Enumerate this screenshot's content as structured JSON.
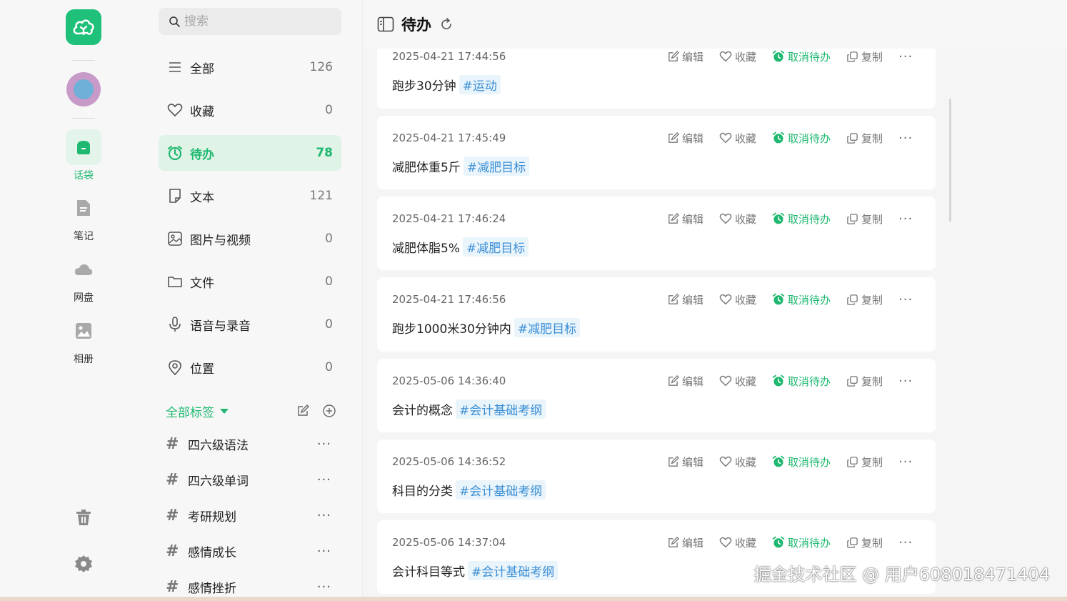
{
  "rail": {
    "nav": [
      {
        "label": "话袋",
        "icon": "bag-icon",
        "active": true
      },
      {
        "label": "笔记",
        "icon": "note-icon",
        "active": false
      },
      {
        "label": "网盘",
        "icon": "cloud-icon",
        "active": false
      },
      {
        "label": "相册",
        "icon": "photo-icon",
        "active": false
      }
    ],
    "bottom_icons": [
      "trash-icon",
      "gear-icon"
    ]
  },
  "search": {
    "placeholder": "搜索"
  },
  "categories": [
    {
      "label": "全部",
      "count": "126",
      "icon": "list-icon"
    },
    {
      "label": "收藏",
      "count": "0",
      "icon": "heart-icon"
    },
    {
      "label": "待办",
      "count": "78",
      "icon": "alarm-icon",
      "active": true
    },
    {
      "label": "文本",
      "count": "121",
      "icon": "doc-icon"
    },
    {
      "label": "图片与视频",
      "count": "0",
      "icon": "image-icon"
    },
    {
      "label": "文件",
      "count": "0",
      "icon": "folder-icon"
    },
    {
      "label": "语音与录音",
      "count": "0",
      "icon": "mic-icon"
    },
    {
      "label": "位置",
      "count": "0",
      "icon": "location-icon"
    }
  ],
  "tags": {
    "header": "全部标签",
    "items": [
      {
        "label": "四六级语法",
        "more": "···"
      },
      {
        "label": "四六级单词",
        "more": "···"
      },
      {
        "label": "考研规划",
        "more": "···"
      },
      {
        "label": "感情成长",
        "more": "···"
      },
      {
        "label": "感情挫折",
        "more": "···"
      }
    ]
  },
  "main": {
    "title": "待办",
    "actions": {
      "edit": "编辑",
      "favorite": "收藏",
      "cancel_todo": "取消待办",
      "copy": "复制",
      "more": "···"
    },
    "items": [
      {
        "time": "2025-04-21 17:44:56",
        "text": "跑步30分钟",
        "tag": "#运动"
      },
      {
        "time": "2025-04-21 17:45:49",
        "text": "减肥体重5斤",
        "tag": "#减肥目标"
      },
      {
        "time": "2025-04-21 17:46:24",
        "text": "减肥体脂5%",
        "tag": "#减肥目标"
      },
      {
        "time": "2025-04-21 17:46:56",
        "text": "跑步1000米30分钟内",
        "tag": "#减肥目标"
      },
      {
        "time": "2025-05-06 14:36:40",
        "text": "会计的概念",
        "tag": "#会计基础考纲"
      },
      {
        "time": "2025-05-06 14:36:52",
        "text": "科目的分类",
        "tag": "#会计基础考纲"
      },
      {
        "time": "2025-05-06 14:37:04",
        "text": "会计科目等式",
        "tag": "#会计基础考纲"
      }
    ]
  },
  "watermark": "掘金技术社区 @ 用户608018471404",
  "colors": {
    "accent": "#1fb870",
    "tag_blue": "#3b8fd6",
    "tag_bg": "#eaf4fb"
  }
}
